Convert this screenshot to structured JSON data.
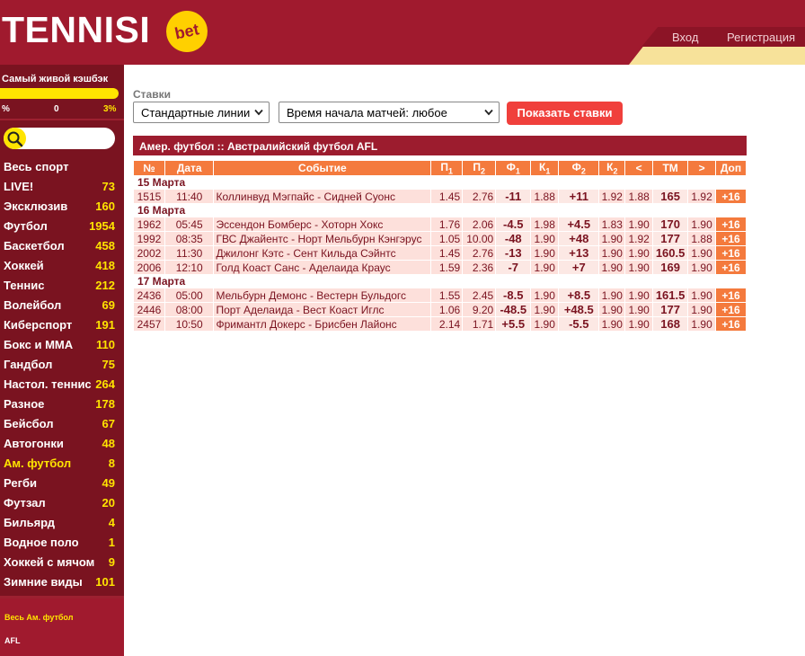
{
  "header": {
    "logo_text": "TENNISI",
    "logo_badge": "bet",
    "login_label": "Вход",
    "register_label": "Регистрация"
  },
  "colors": {
    "brand_red": "#a01a2e",
    "sidebar_bg": "#7a1320",
    "accent_yellow": "#ffe400",
    "accent_orange": "#f47a3d",
    "button_red": "#f0403c",
    "row_bg": "#fde0db"
  },
  "sidebar": {
    "cashback_title": "Самый живой кэшбэк",
    "cashback_min": "%",
    "cashback_mid": "0",
    "cashback_max": "3%",
    "search_icon": "search-icon",
    "sports": [
      {
        "name": "Весь спорт",
        "count": ""
      },
      {
        "name": "LIVE!",
        "count": "73"
      },
      {
        "name": "Эксклюзив",
        "count": "160"
      },
      {
        "name": "Футбол",
        "count": "1954"
      },
      {
        "name": "Баскетбол",
        "count": "458"
      },
      {
        "name": "Хоккей",
        "count": "418"
      },
      {
        "name": "Теннис",
        "count": "212"
      },
      {
        "name": "Волейбол",
        "count": "69"
      },
      {
        "name": "Киберспорт",
        "count": "191"
      },
      {
        "name": "Бокс и MMA",
        "count": "110"
      },
      {
        "name": "Гандбол",
        "count": "75"
      },
      {
        "name": "Настол. теннис",
        "count": "264"
      },
      {
        "name": "Разное",
        "count": "178"
      },
      {
        "name": "Бейсбол",
        "count": "67"
      },
      {
        "name": "Автогонки",
        "count": "48"
      },
      {
        "name": "Ам. футбол",
        "count": "8",
        "active": true
      },
      {
        "name": "Регби",
        "count": "49"
      },
      {
        "name": "Футзал",
        "count": "20"
      },
      {
        "name": "Бильярд",
        "count": "4"
      },
      {
        "name": "Водное поло",
        "count": "1"
      },
      {
        "name": "Хоккей с мячом",
        "count": "9"
      },
      {
        "name": "Зимние виды",
        "count": "101"
      }
    ],
    "sub_all": "Весь Ам. футбол",
    "sub_afl": "AFL"
  },
  "filters": {
    "label": "Ставки",
    "lines_value": "Стандартные линии",
    "time_value": "Время начала матчей: любое",
    "show_button": "Показать ставки"
  },
  "table": {
    "title": "Амер. футбол :: Австралийский футбол AFL",
    "headers": {
      "num": "№",
      "date": "Дата",
      "event": "Событие",
      "p": "П",
      "f": "Ф",
      "k": "К",
      "sub1": "1",
      "sub2": "2",
      "less": "<",
      "tm": "ТМ",
      "more": ">",
      "extra": "Доп"
    },
    "groups": [
      {
        "date": "15 Марта",
        "matches": [
          {
            "num": "1515",
            "time": "11:40",
            "event": "Коллинвуд Мэгпайс - Сидней Суонс",
            "p1": "1.45",
            "p2": "2.76",
            "f1": "-11",
            "k1": "1.88",
            "f2": "+11",
            "k2": "1.92",
            "less": "1.88",
            "tm": "165",
            "more": "1.92",
            "extra": "+16"
          }
        ]
      },
      {
        "date": "16 Марта",
        "matches": [
          {
            "num": "1962",
            "time": "05:45",
            "event": "Эссендон Бомберс - Хоторн Хокс",
            "p1": "1.76",
            "p2": "2.06",
            "f1": "-4.5",
            "k1": "1.98",
            "f2": "+4.5",
            "k2": "1.83",
            "less": "1.90",
            "tm": "170",
            "more": "1.90",
            "extra": "+16"
          },
          {
            "num": "1992",
            "time": "08:35",
            "event": "ГВС Джайентс - Норт Мельбурн Кэнгэрус",
            "p1": "1.05",
            "p2": "10.00",
            "f1": "-48",
            "k1": "1.90",
            "f2": "+48",
            "k2": "1.90",
            "less": "1.92",
            "tm": "177",
            "more": "1.88",
            "extra": "+16"
          },
          {
            "num": "2002",
            "time": "11:30",
            "event": "Джилонг Кэтс - Сент Кильда Сэйнтс",
            "p1": "1.45",
            "p2": "2.76",
            "f1": "-13",
            "k1": "1.90",
            "f2": "+13",
            "k2": "1.90",
            "less": "1.90",
            "tm": "160.5",
            "more": "1.90",
            "extra": "+16"
          },
          {
            "num": "2006",
            "time": "12:10",
            "event": "Голд Коаст Санс - Аделаида Краус",
            "p1": "1.59",
            "p2": "2.36",
            "f1": "-7",
            "k1": "1.90",
            "f2": "+7",
            "k2": "1.90",
            "less": "1.90",
            "tm": "169",
            "more": "1.90",
            "extra": "+16"
          }
        ]
      },
      {
        "date": "17 Марта",
        "matches": [
          {
            "num": "2436",
            "time": "05:00",
            "event": "Мельбурн Демонс - Вестерн Бульдогс",
            "p1": "1.55",
            "p2": "2.45",
            "f1": "-8.5",
            "k1": "1.90",
            "f2": "+8.5",
            "k2": "1.90",
            "less": "1.90",
            "tm": "161.5",
            "more": "1.90",
            "extra": "+16"
          },
          {
            "num": "2446",
            "time": "08:00",
            "event": "Порт Аделаида - Вест Коаст Иглс",
            "p1": "1.06",
            "p2": "9.20",
            "f1": "-48.5",
            "k1": "1.90",
            "f2": "+48.5",
            "k2": "1.90",
            "less": "1.90",
            "tm": "177",
            "more": "1.90",
            "extra": "+16"
          },
          {
            "num": "2457",
            "time": "10:50",
            "event": "Фримантл Докерс - Брисбен Лайонс",
            "p1": "2.14",
            "p2": "1.71",
            "f1": "+5.5",
            "k1": "1.90",
            "f2": "-5.5",
            "k2": "1.90",
            "less": "1.90",
            "tm": "168",
            "more": "1.90",
            "extra": "+16"
          }
        ]
      }
    ]
  }
}
